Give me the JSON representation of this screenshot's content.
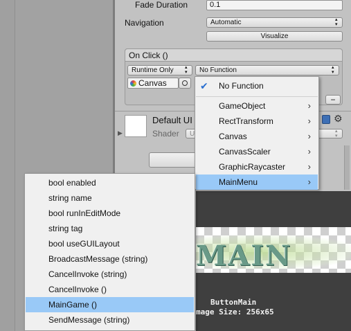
{
  "inspector": {
    "fade_duration_label": "Fade Duration",
    "fade_duration_value": "0.1",
    "navigation_label": "Navigation",
    "navigation_value": "Automatic",
    "visualize_label": "Visualize",
    "onclick_header": "On Click ()",
    "runtime_value": "Runtime Only",
    "function_value": "No Function",
    "canvas_object": "Canvas",
    "minus_label": "−",
    "material_name": "Default UI",
    "shader_label": "Shader",
    "shader_value": "U"
  },
  "function_menu": {
    "items": [
      {
        "label": "No Function",
        "checked": true
      },
      {
        "label": "GameObject"
      },
      {
        "label": "RectTransform"
      },
      {
        "label": "Canvas"
      },
      {
        "label": "CanvasScaler"
      },
      {
        "label": "GraphicRaycaster"
      },
      {
        "label": "MainMenu",
        "selected": true
      }
    ]
  },
  "method_menu": {
    "items": [
      {
        "label": "bool enabled"
      },
      {
        "label": "string name"
      },
      {
        "label": "bool runInEditMode"
      },
      {
        "label": "string tag"
      },
      {
        "label": "bool useGUILayout"
      },
      {
        "label": "BroadcastMessage (string)"
      },
      {
        "label": "CancelInvoke (string)"
      },
      {
        "label": "CancelInvoke ()"
      },
      {
        "label": "MainGame ()",
        "selected": true
      },
      {
        "label": "SendMessage (string)"
      }
    ]
  },
  "preview": {
    "art_text": "MAIN",
    "sprite_name": "ButtonMain",
    "image_size": "mage Size: 256x65"
  },
  "colors": {
    "menu_highlight": "#99c9f7",
    "inspector_bg": "#c2c2c2",
    "preview_bg": "#3f3f3f"
  },
  "icons": [
    "checkmark-icon",
    "chevron-right-icon",
    "canvas-object-icon",
    "object-picker-icon",
    "help-book-icon",
    "gear-icon",
    "foldout-arrow-icon"
  ]
}
